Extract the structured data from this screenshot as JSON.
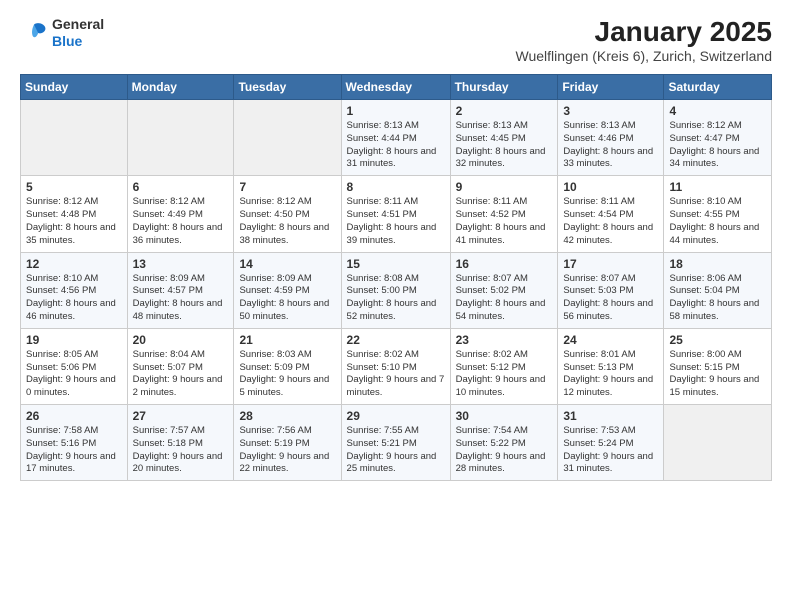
{
  "header": {
    "logo_general": "General",
    "logo_blue": "Blue",
    "month_title": "January 2025",
    "location": "Wuelflingen (Kreis 6), Zurich, Switzerland"
  },
  "days_of_week": [
    "Sunday",
    "Monday",
    "Tuesday",
    "Wednesday",
    "Thursday",
    "Friday",
    "Saturday"
  ],
  "weeks": [
    {
      "cells": [
        {
          "empty": true
        },
        {
          "empty": true
        },
        {
          "empty": true
        },
        {
          "day": 1,
          "sunrise": "8:13 AM",
          "sunset": "4:44 PM",
          "daylight": "8 hours and 31 minutes."
        },
        {
          "day": 2,
          "sunrise": "8:13 AM",
          "sunset": "4:45 PM",
          "daylight": "8 hours and 32 minutes."
        },
        {
          "day": 3,
          "sunrise": "8:13 AM",
          "sunset": "4:46 PM",
          "daylight": "8 hours and 33 minutes."
        },
        {
          "day": 4,
          "sunrise": "8:12 AM",
          "sunset": "4:47 PM",
          "daylight": "8 hours and 34 minutes."
        }
      ]
    },
    {
      "cells": [
        {
          "day": 5,
          "sunrise": "8:12 AM",
          "sunset": "4:48 PM",
          "daylight": "8 hours and 35 minutes."
        },
        {
          "day": 6,
          "sunrise": "8:12 AM",
          "sunset": "4:49 PM",
          "daylight": "8 hours and 36 minutes."
        },
        {
          "day": 7,
          "sunrise": "8:12 AM",
          "sunset": "4:50 PM",
          "daylight": "8 hours and 38 minutes."
        },
        {
          "day": 8,
          "sunrise": "8:11 AM",
          "sunset": "4:51 PM",
          "daylight": "8 hours and 39 minutes."
        },
        {
          "day": 9,
          "sunrise": "8:11 AM",
          "sunset": "4:52 PM",
          "daylight": "8 hours and 41 minutes."
        },
        {
          "day": 10,
          "sunrise": "8:11 AM",
          "sunset": "4:54 PM",
          "daylight": "8 hours and 42 minutes."
        },
        {
          "day": 11,
          "sunrise": "8:10 AM",
          "sunset": "4:55 PM",
          "daylight": "8 hours and 44 minutes."
        }
      ]
    },
    {
      "cells": [
        {
          "day": 12,
          "sunrise": "8:10 AM",
          "sunset": "4:56 PM",
          "daylight": "8 hours and 46 minutes."
        },
        {
          "day": 13,
          "sunrise": "8:09 AM",
          "sunset": "4:57 PM",
          "daylight": "8 hours and 48 minutes."
        },
        {
          "day": 14,
          "sunrise": "8:09 AM",
          "sunset": "4:59 PM",
          "daylight": "8 hours and 50 minutes."
        },
        {
          "day": 15,
          "sunrise": "8:08 AM",
          "sunset": "5:00 PM",
          "daylight": "8 hours and 52 minutes."
        },
        {
          "day": 16,
          "sunrise": "8:07 AM",
          "sunset": "5:02 PM",
          "daylight": "8 hours and 54 minutes."
        },
        {
          "day": 17,
          "sunrise": "8:07 AM",
          "sunset": "5:03 PM",
          "daylight": "8 hours and 56 minutes."
        },
        {
          "day": 18,
          "sunrise": "8:06 AM",
          "sunset": "5:04 PM",
          "daylight": "8 hours and 58 minutes."
        }
      ]
    },
    {
      "cells": [
        {
          "day": 19,
          "sunrise": "8:05 AM",
          "sunset": "5:06 PM",
          "daylight": "9 hours and 0 minutes."
        },
        {
          "day": 20,
          "sunrise": "8:04 AM",
          "sunset": "5:07 PM",
          "daylight": "9 hours and 2 minutes."
        },
        {
          "day": 21,
          "sunrise": "8:03 AM",
          "sunset": "5:09 PM",
          "daylight": "9 hours and 5 minutes."
        },
        {
          "day": 22,
          "sunrise": "8:02 AM",
          "sunset": "5:10 PM",
          "daylight": "9 hours and 7 minutes."
        },
        {
          "day": 23,
          "sunrise": "8:02 AM",
          "sunset": "5:12 PM",
          "daylight": "9 hours and 10 minutes."
        },
        {
          "day": 24,
          "sunrise": "8:01 AM",
          "sunset": "5:13 PM",
          "daylight": "9 hours and 12 minutes."
        },
        {
          "day": 25,
          "sunrise": "8:00 AM",
          "sunset": "5:15 PM",
          "daylight": "9 hours and 15 minutes."
        }
      ]
    },
    {
      "cells": [
        {
          "day": 26,
          "sunrise": "7:58 AM",
          "sunset": "5:16 PM",
          "daylight": "9 hours and 17 minutes."
        },
        {
          "day": 27,
          "sunrise": "7:57 AM",
          "sunset": "5:18 PM",
          "daylight": "9 hours and 20 minutes."
        },
        {
          "day": 28,
          "sunrise": "7:56 AM",
          "sunset": "5:19 PM",
          "daylight": "9 hours and 22 minutes."
        },
        {
          "day": 29,
          "sunrise": "7:55 AM",
          "sunset": "5:21 PM",
          "daylight": "9 hours and 25 minutes."
        },
        {
          "day": 30,
          "sunrise": "7:54 AM",
          "sunset": "5:22 PM",
          "daylight": "9 hours and 28 minutes."
        },
        {
          "day": 31,
          "sunrise": "7:53 AM",
          "sunset": "5:24 PM",
          "daylight": "9 hours and 31 minutes."
        },
        {
          "empty": true
        }
      ]
    }
  ]
}
